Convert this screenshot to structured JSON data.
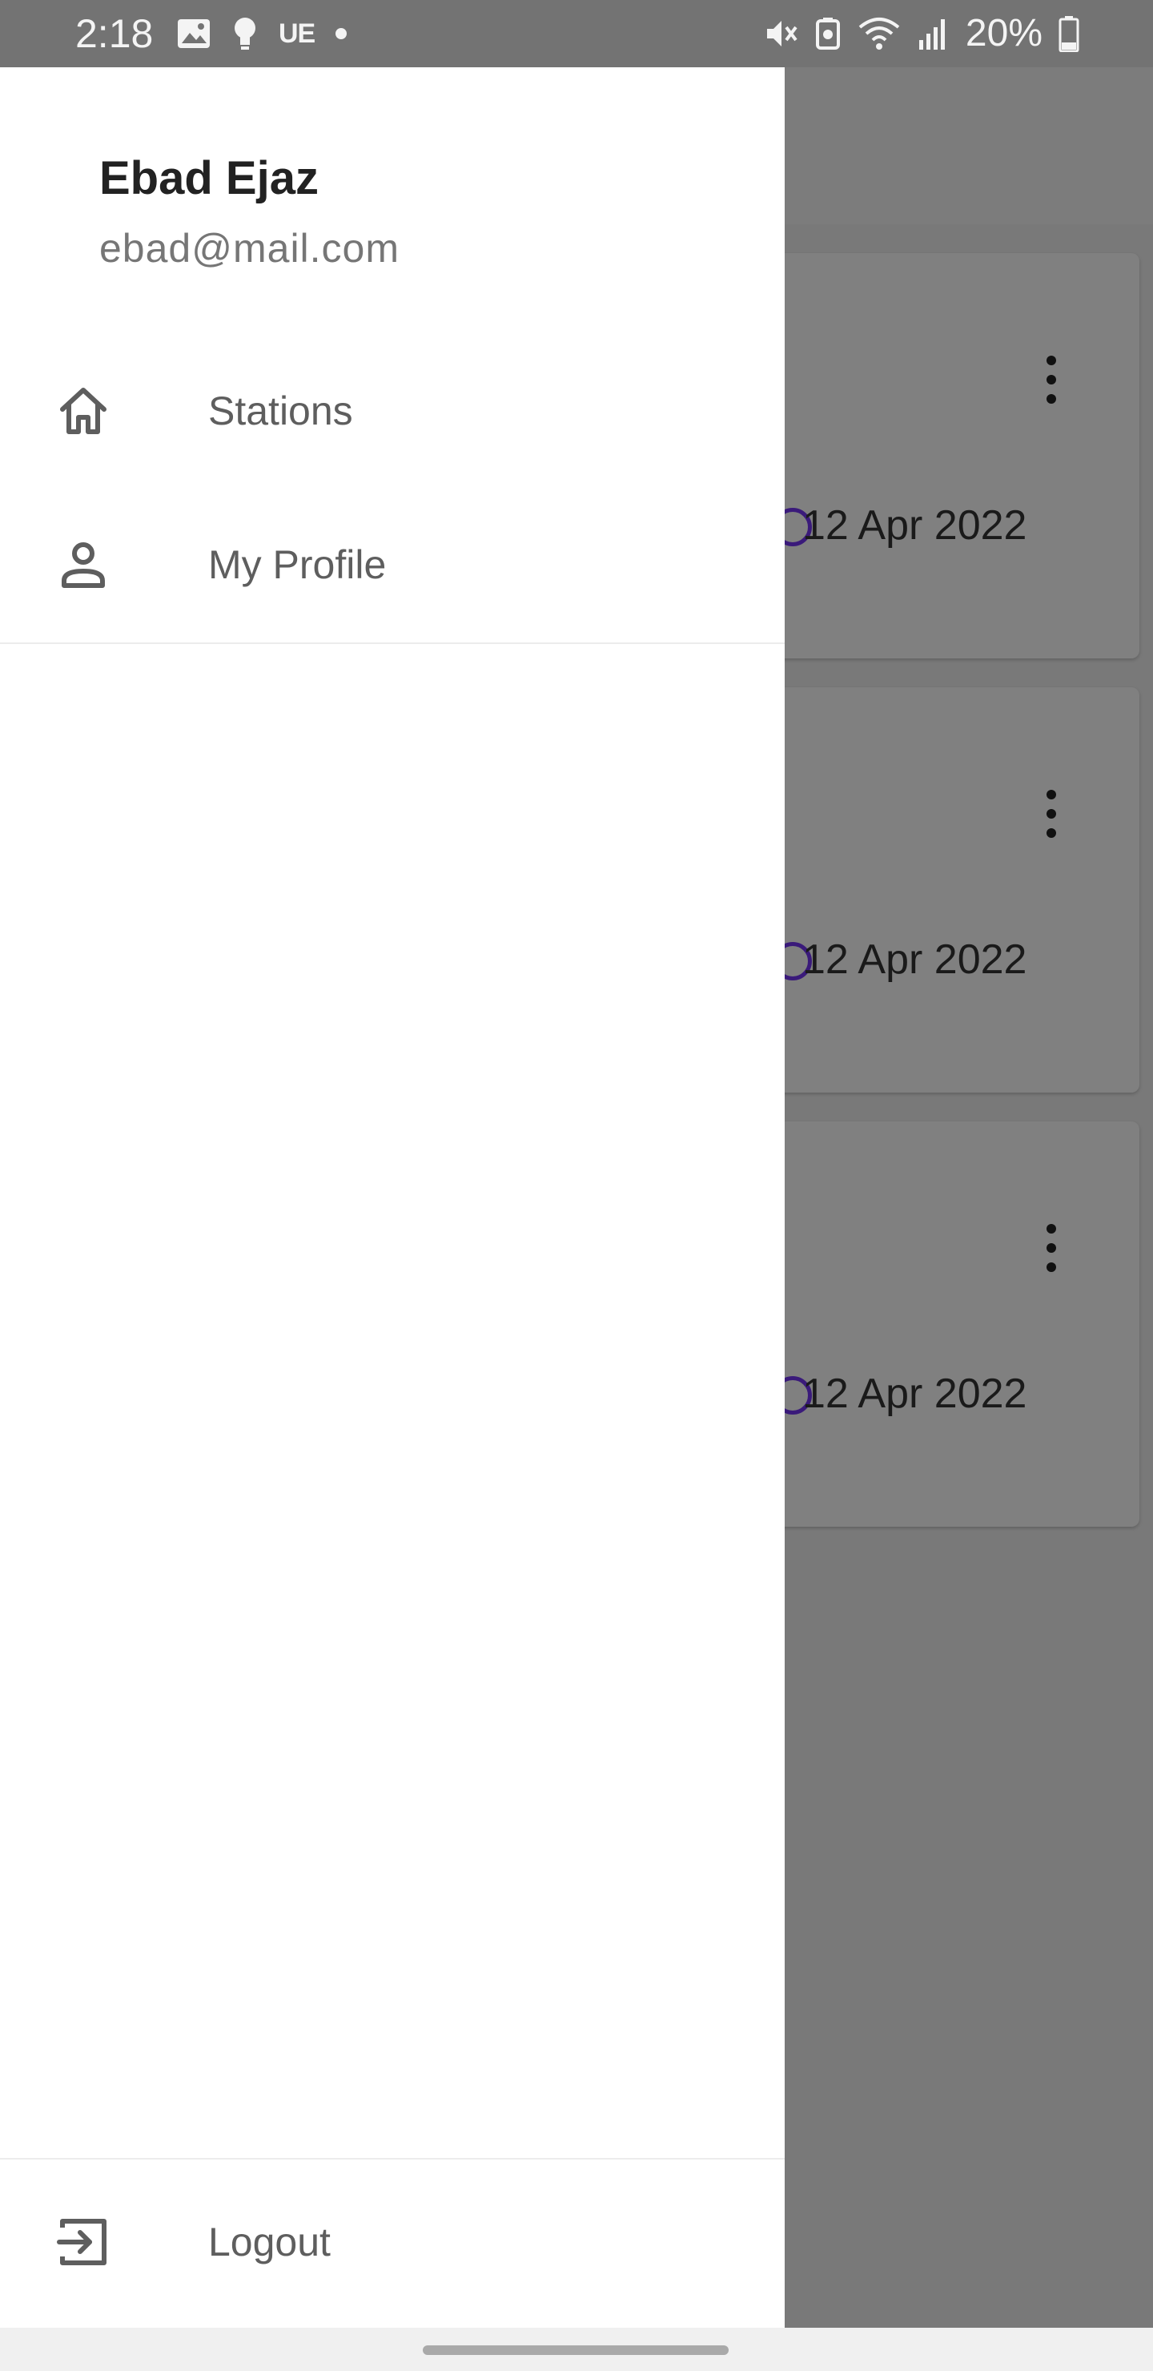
{
  "status_bar": {
    "time": "2:18",
    "carrier_label": "UE",
    "battery": "20%",
    "left_icons": [
      "gallery-icon",
      "bulb-icon",
      "carrier-label",
      "dot-icon"
    ],
    "right_icons": [
      "mute-icon",
      "nfc-icon",
      "wifi-icon",
      "signal-icon",
      "battery-icon"
    ]
  },
  "drawer": {
    "user_name": "Ebad Ejaz",
    "user_email": "ebad@mail.com",
    "items": [
      {
        "label": "Stations",
        "icon": "home-icon"
      },
      {
        "label": "My Profile",
        "icon": "person-icon"
      }
    ],
    "logout": {
      "label": "Logout",
      "icon": "logout-icon"
    }
  },
  "background_cards": [
    {
      "date": "12 Apr 2022"
    },
    {
      "date": "12 Apr 2022"
    },
    {
      "date": "12 Apr 2022"
    }
  ],
  "colors": {
    "scrim": "#797979",
    "drawer_bg": "#ffffff",
    "accent": "#3a1a7a"
  }
}
